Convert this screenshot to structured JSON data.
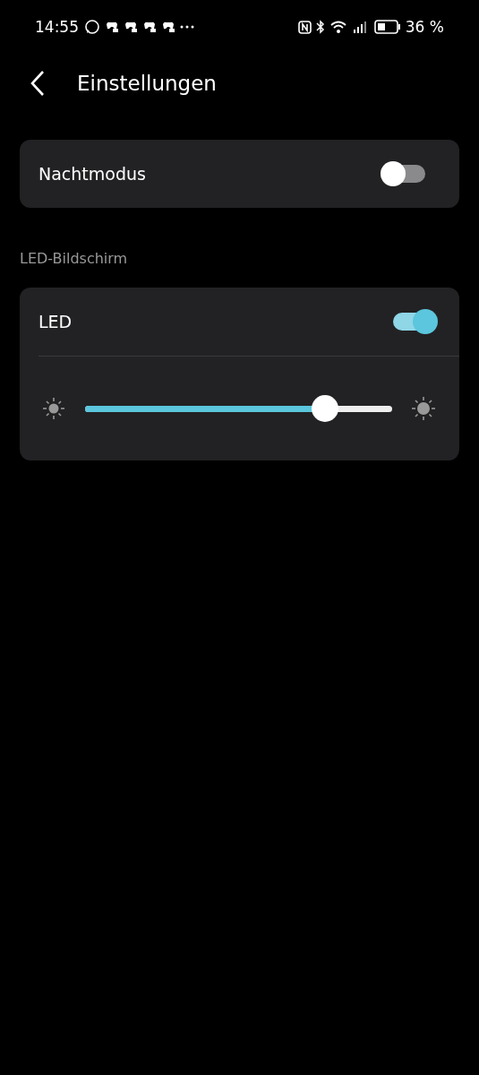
{
  "status_bar": {
    "time": "14:55",
    "battery": "36 %"
  },
  "header": {
    "title": "Einstellungen"
  },
  "night_mode": {
    "label": "Nachtmodus",
    "on": false
  },
  "section": {
    "title": "LED-Bildschirm"
  },
  "led": {
    "label": "LED",
    "on": true,
    "brightness": {
      "level": 0.78
    }
  }
}
